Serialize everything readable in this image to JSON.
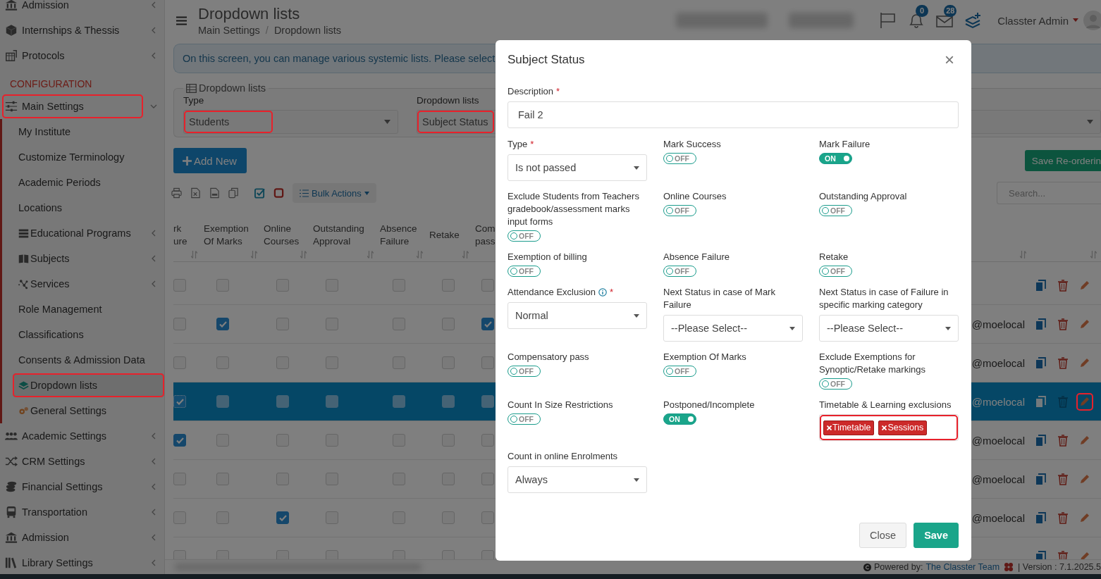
{
  "sidebar": {
    "items": [
      {
        "kind": "item",
        "label": "Admission",
        "expanded": false
      },
      {
        "kind": "item",
        "label": "Internships & Thessis",
        "expanded": false
      },
      {
        "kind": "item",
        "label": "Protocols",
        "expanded": false
      },
      {
        "kind": "section",
        "label": "CONFIGURATION"
      },
      {
        "kind": "item",
        "label": "Main Settings",
        "expanded": true,
        "highlighted": true,
        "children": [
          {
            "label": "My Institute",
            "selected": false
          },
          {
            "label": "Customize Terminology",
            "selected": false
          },
          {
            "label": "Academic Periods",
            "selected": false
          },
          {
            "label": "Locations",
            "selected": false
          },
          {
            "label": "Educational Programs",
            "selected": false,
            "expanded": false
          },
          {
            "label": "Subjects",
            "selected": false,
            "expanded": false
          },
          {
            "label": "Services",
            "selected": false,
            "expanded": false
          },
          {
            "label": "Role Management",
            "selected": false
          },
          {
            "label": "Classifications",
            "selected": false
          },
          {
            "label": "Consents & Admission Data",
            "selected": false
          },
          {
            "label": "Dropdown lists",
            "selected": true,
            "highlighted": true
          },
          {
            "label": "General Settings",
            "selected": false
          }
        ]
      },
      {
        "kind": "item",
        "label": "Academic Settings",
        "expanded": false
      },
      {
        "kind": "item",
        "label": "CRM Settings",
        "expanded": false
      },
      {
        "kind": "item",
        "label": "Financial Settings",
        "expanded": false
      },
      {
        "kind": "item",
        "label": "Transportation",
        "expanded": false
      },
      {
        "kind": "item",
        "label": "Admission",
        "expanded": false
      },
      {
        "kind": "item",
        "label": "Library Settings",
        "expanded": false
      }
    ]
  },
  "header": {
    "title": "Dropdown lists",
    "breadcrumb": [
      "Main Settings",
      "Dropdown lists"
    ],
    "separator": "/",
    "notifications": "0",
    "messages": "28",
    "user": "Classter Admin"
  },
  "info_banner": "On this screen, you can manage various systemic lists. Please select",
  "filters": {
    "legend": "Dropdown lists",
    "type_label": "Type",
    "type_value": "Students",
    "type_highlighted": true,
    "list_label": "Dropdown lists",
    "list_value": "Subject Status",
    "list_highlighted": true
  },
  "add_button": "Add New",
  "save_order_button": "Save Re-orderin",
  "bulk_actions": "Bulk Actions",
  "search": {
    "placeholder": "Search..."
  },
  "table": {
    "columns": [
      "rk ure",
      "Exemption Of Marks",
      "Online Courses",
      "Outstanding Approval",
      "Absence Failure",
      "Retake",
      "Com pass"
    ],
    "rows": [
      {
        "selected": false,
        "checks": [
          false,
          false,
          false,
          false,
          false,
          false,
          false
        ],
        "edit_highlighted": false
      },
      {
        "selected": false,
        "checks": [
          false,
          true,
          false,
          false,
          false,
          false,
          true
        ],
        "column_8": "@moelocal",
        "edit_highlighted": false
      },
      {
        "selected": false,
        "checks": [
          false,
          false,
          false,
          false,
          false,
          false,
          false
        ],
        "column_8": "@moelocal",
        "edit_highlighted": false
      },
      {
        "selected": true,
        "checks": [
          true,
          false,
          false,
          false,
          false,
          false,
          false
        ],
        "column_8": "@moelocal",
        "edit_highlighted": true
      },
      {
        "selected": false,
        "checks": [
          true,
          false,
          false,
          false,
          false,
          false,
          false
        ],
        "column_8": "@moelocal",
        "edit_highlighted": false
      },
      {
        "selected": false,
        "checks": [
          false,
          false,
          false,
          false,
          false,
          false,
          false
        ],
        "column_8": "@moelocal",
        "edit_highlighted": false
      },
      {
        "selected": false,
        "checks": [
          false,
          false,
          true,
          false,
          false,
          false,
          false
        ],
        "column_8": "@moelocal",
        "edit_highlighted": false
      },
      {
        "selected": false,
        "checks": [
          false,
          false,
          false,
          false,
          false,
          false,
          false
        ],
        "edit_highlighted": false
      }
    ]
  },
  "footer": {
    "powered_by": "Powered by:",
    "team": "The Classter Team",
    "version": "| Version : 7.1.2025.5"
  },
  "modal": {
    "title": "Subject Status",
    "close": "×",
    "description": {
      "label": "Description",
      "asterisk": "*",
      "value": "Fail 2"
    },
    "fields": [
      {
        "kind": "select",
        "label": "Type",
        "asterisk": "*",
        "value": "Is not passed"
      },
      {
        "kind": "toggle",
        "label": "Mark Success",
        "on": false,
        "text": "OFF"
      },
      {
        "kind": "toggle",
        "label": "Mark Failure",
        "on": true,
        "text": "ON"
      },
      {
        "kind": "toggle",
        "label": "Exclude Students from Teachers gradebook/assessment marks input forms",
        "on": false,
        "text": "OFF"
      },
      {
        "kind": "toggle",
        "label": "Online Courses",
        "on": false,
        "text": "OFF"
      },
      {
        "kind": "toggle",
        "label": "Outstanding Approval",
        "on": false,
        "text": "OFF"
      },
      {
        "kind": "toggle",
        "label": "Exemption of billing",
        "on": false,
        "text": "OFF"
      },
      {
        "kind": "toggle",
        "label": "Absence Failure",
        "on": false,
        "text": "OFF"
      },
      {
        "kind": "toggle",
        "label": "Retake",
        "on": false,
        "text": "OFF"
      },
      {
        "kind": "select",
        "label": "Attendance Exclusion",
        "info": true,
        "asterisk": "*",
        "value": "Normal"
      },
      {
        "kind": "select",
        "label": "Next Status in case of Mark Failure",
        "value": "--Please Select--"
      },
      {
        "kind": "select",
        "label": "Next Status in case of Failure in specific marking category",
        "value": "--Please Select--"
      },
      {
        "kind": "toggle",
        "label": "Compensatory pass",
        "on": false,
        "text": "OFF"
      },
      {
        "kind": "toggle",
        "label": "Exemption Of Marks",
        "on": false,
        "text": "OFF"
      },
      {
        "kind": "toggle",
        "label": "Exclude Exemptions for Synoptic/Retake markings",
        "on": false,
        "text": "OFF"
      },
      {
        "kind": "toggle",
        "label": "Count In Size Restrictions",
        "on": false,
        "text": "OFF"
      },
      {
        "kind": "toggle",
        "label": "Postponed/Incomplete",
        "on": true,
        "text": "ON"
      },
      {
        "kind": "tags",
        "label": "Timetable & Learning exclusions",
        "highlighted": true,
        "tags": [
          "Timetable",
          "Sessions"
        ]
      },
      {
        "kind": "select",
        "label": "Count in online Enrolments",
        "value": "Always"
      }
    ],
    "buttons": [
      {
        "label": "Close",
        "kind": "secondary"
      },
      {
        "label": "Save",
        "kind": "primary"
      }
    ]
  }
}
